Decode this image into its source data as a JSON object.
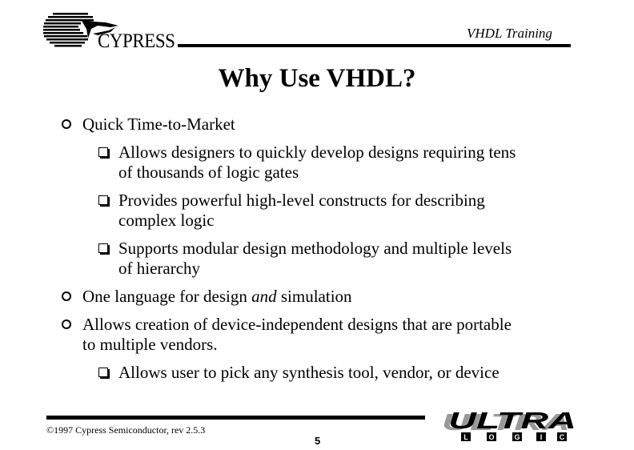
{
  "header": {
    "logo_text": "CYPRESS",
    "course_title": "VHDL Training"
  },
  "title": "Why Use VHDL?",
  "bullets": [
    {
      "text": "Quick Time-to-Market",
      "sub": [
        {
          "line1": "Allows designers to quickly develop designs requiring tens",
          "line2": "of thousands of logic gates"
        },
        {
          "line1": "Provides powerful high-level constructs for describing",
          "line2": "complex logic"
        },
        {
          "line1": "Supports modular design methodology and multiple levels",
          "line2": "of hierarchy"
        }
      ]
    },
    {
      "text_before": "One language for design ",
      "text_italic": "and",
      "text_after": " simulation"
    },
    {
      "line1": "Allows creation of device-independent designs that are portable",
      "line2": "to multiple vendors.",
      "sub": [
        {
          "line1": "Allows user to pick any synthesis tool, vendor, or device"
        }
      ]
    }
  ],
  "footer": {
    "copyright": "©1997 Cypress Semiconductor, rev 2.5.3",
    "page_number": "5",
    "logo_main": "ULTRA",
    "logo_sub": [
      "L",
      "O",
      "G",
      "I",
      "C"
    ]
  }
}
